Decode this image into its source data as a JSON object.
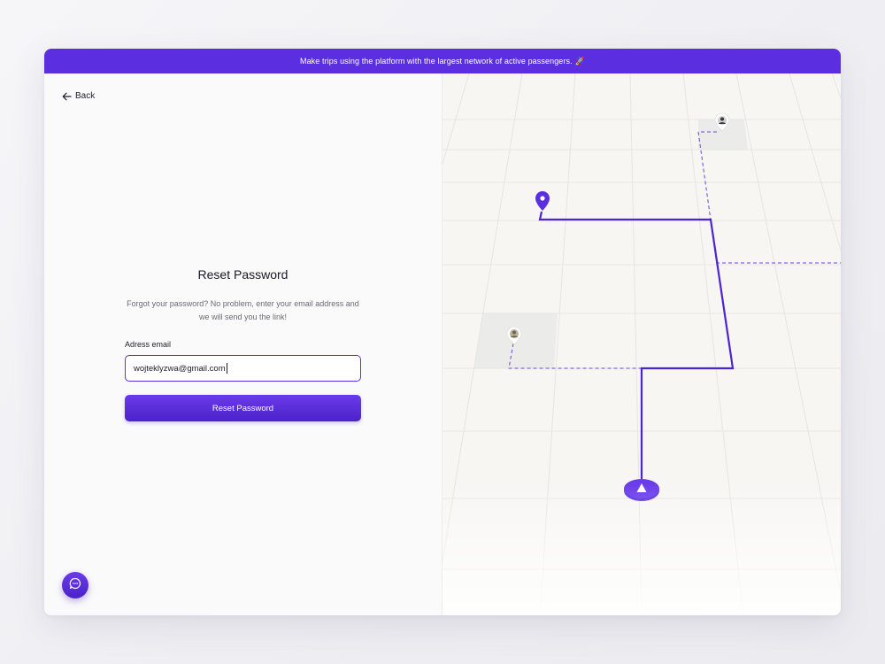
{
  "banner": {
    "text": "Make trips using the platform with the largest network of active passengers.",
    "emoji": "🚀"
  },
  "nav": {
    "back_label": "Back"
  },
  "form": {
    "title": "Reset Password",
    "description": "Forgot your password? No problem, enter your email address and we will send you the link!",
    "email_label": "Adress email",
    "email_value": "wojteklyzwa@gmail.com",
    "submit_label": "Reset Password"
  },
  "colors": {
    "accent": "#5b2fe0",
    "accent_dark": "#4c22c9",
    "map_background": "#f7f6f3",
    "route": "#4b24d6"
  },
  "icons": {
    "back": "arrow-left-icon",
    "chat": "chat-bubble-icon",
    "destination": "map-pin-icon",
    "start": "navigation-arrow-icon",
    "passengers": "avatar-pin-icon"
  }
}
